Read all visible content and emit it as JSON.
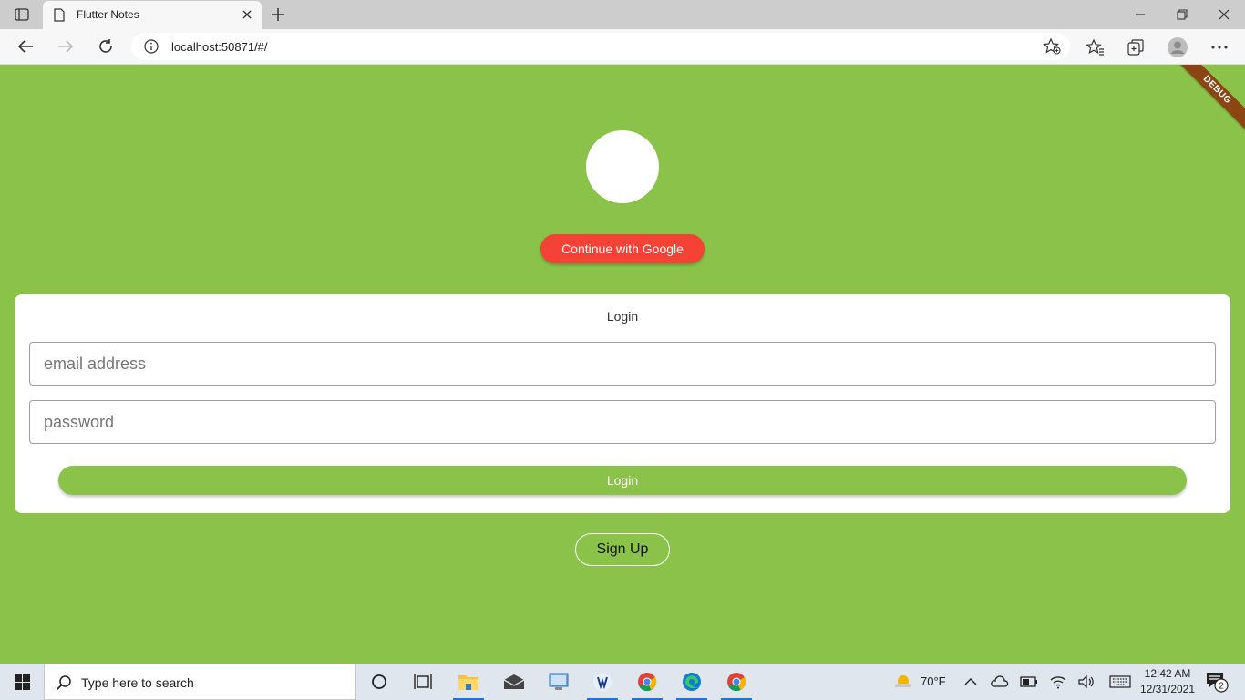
{
  "browser": {
    "tab_title": "Flutter Notes",
    "url": "localhost:50871/#/"
  },
  "app": {
    "debug_label": "DEBUG",
    "google_button": "Continue with Google",
    "card_title": "Login",
    "email_placeholder": "email address",
    "password_placeholder": "password",
    "login_button": "Login",
    "signup_button": "Sign Up"
  },
  "taskbar": {
    "search_placeholder": "Type here to search",
    "weather": "70°F",
    "time": "12:42 AM",
    "date": "12/31/2021",
    "notification_count": "2"
  },
  "colors": {
    "page_background": "#8bc34a",
    "google_button": "#f44336",
    "debug_ribbon": "#8b4513"
  }
}
